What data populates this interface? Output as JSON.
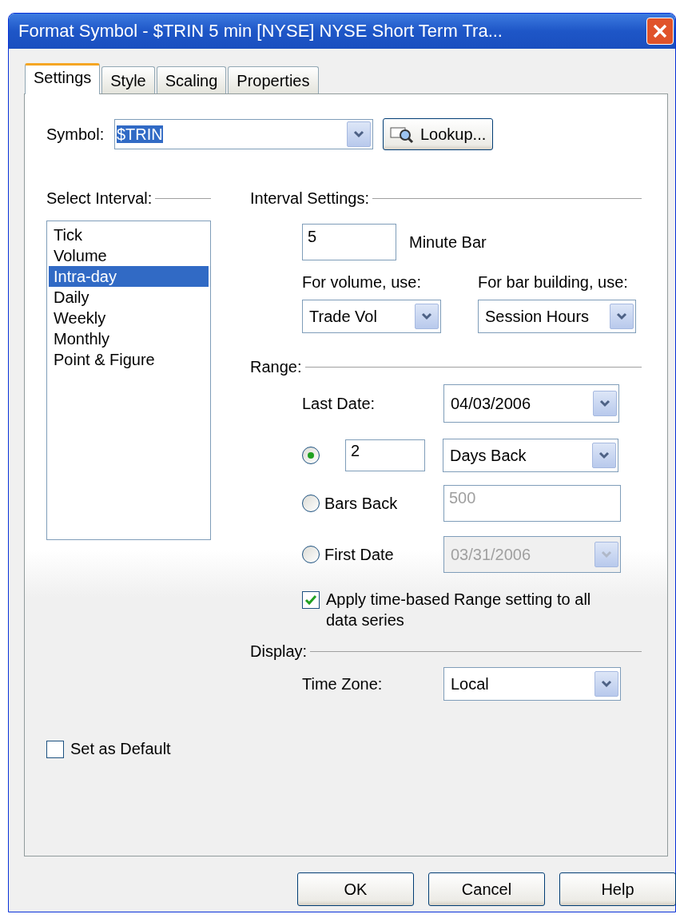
{
  "window": {
    "title": "Format Symbol - $TRIN  5 min  [NYSE] NYSE Short Term Tra..."
  },
  "tabs": [
    {
      "label": "Settings",
      "selected": true
    },
    {
      "label": "Style",
      "selected": false
    },
    {
      "label": "Scaling",
      "selected": false
    },
    {
      "label": "Properties",
      "selected": false
    }
  ],
  "symbol": {
    "label": "Symbol:",
    "value": "$TRIN",
    "button": "Lookup..."
  },
  "interval_list": {
    "label": "Select Interval:",
    "items": [
      {
        "label": "Tick",
        "selected": false
      },
      {
        "label": "Volume",
        "selected": false
      },
      {
        "label": "Intra-day",
        "selected": true
      },
      {
        "label": "Daily",
        "selected": false
      },
      {
        "label": "Weekly",
        "selected": false
      },
      {
        "label": "Monthly",
        "selected": false
      },
      {
        "label": "Point & Figure",
        "selected": false
      }
    ]
  },
  "interval_settings": {
    "label": "Interval Settings:",
    "value": "5",
    "unit": "Minute Bar",
    "volume_label": "For volume, use:",
    "volume_value": "Trade Vol",
    "bar_label": "For bar building, use:",
    "bar_value": "Session Hours"
  },
  "range": {
    "label": "Range:",
    "last_date_label": "Last Date:",
    "last_date_value": "04/03/2006",
    "options": [
      {
        "kind": "count",
        "value": "2",
        "unit": "Days Back",
        "selected": true,
        "disabled": false
      },
      {
        "kind": "field",
        "label": "Bars Back",
        "value": "500",
        "selected": false,
        "disabled": true
      },
      {
        "kind": "date",
        "label": "First Date",
        "value": "03/31/2006",
        "selected": false,
        "disabled": true
      }
    ],
    "apply": {
      "label": "Apply time-based Range setting to all data series",
      "checked": true
    }
  },
  "display": {
    "label": "Display:",
    "time_zone_label": "Time Zone:",
    "time_zone_value": "Local"
  },
  "set_default": {
    "label": "Set as Default",
    "checked": false
  },
  "buttons": [
    "OK",
    "Cancel",
    "Help"
  ]
}
